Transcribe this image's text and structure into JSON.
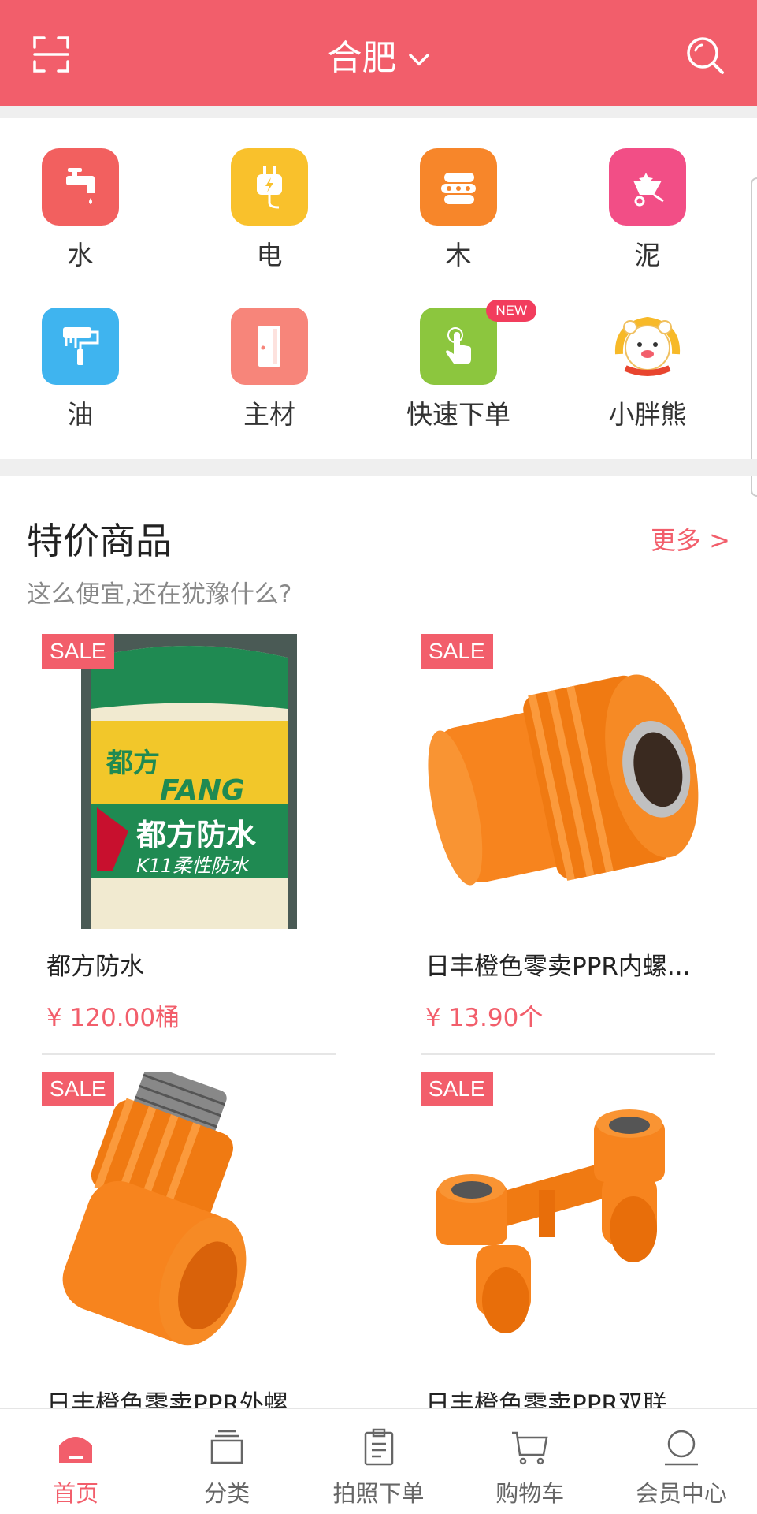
{
  "header": {
    "city": "合肥",
    "scan_icon": "scan-icon",
    "search_icon": "search-icon",
    "bg_color": "#f25e6b"
  },
  "categories": [
    {
      "label": "水",
      "icon": "faucet-icon",
      "color": "#f2605f"
    },
    {
      "label": "电",
      "icon": "plug-icon",
      "color": "#f9c12c"
    },
    {
      "label": "木",
      "icon": "logs-icon",
      "color": "#f7862a"
    },
    {
      "label": "泥",
      "icon": "wheelbarrow-icon",
      "color": "#f24e86"
    },
    {
      "label": "油",
      "icon": "paint-roller-icon",
      "color": "#3fb4ef"
    },
    {
      "label": "主材",
      "icon": "door-icon",
      "color": "#f7857a"
    },
    {
      "label": "快速下单",
      "icon": "tap-hand-icon",
      "color": "#8cc63e",
      "badge": "NEW"
    },
    {
      "label": "小胖熊",
      "icon": "bear-mascot-icon",
      "color": "#ffffff"
    }
  ],
  "sale_section": {
    "title": "特价商品",
    "more": "更多 >",
    "subtitle": "这么便宜,还在犹豫什么?"
  },
  "products": [
    {
      "name": "都方防水",
      "price": "¥ 120.00桶",
      "tag": "SALE",
      "pic_text_1": "都方",
      "pic_text_2": "都方防水",
      "pic_text_3": "K11柔性防水",
      "pic_text_4": "FANG"
    },
    {
      "name": "日丰橙色零卖PPR内螺...",
      "price": "¥ 13.90个",
      "tag": "SALE"
    },
    {
      "name": "日丰橙色零卖PPR外螺",
      "price": "",
      "tag": "SALE"
    },
    {
      "name": "日丰橙色零卖PPR双联",
      "price": "",
      "tag": "SALE"
    }
  ],
  "tabbar": [
    {
      "label": "首页",
      "icon": "home-icon",
      "active": true
    },
    {
      "label": "分类",
      "icon": "category-icon",
      "active": false
    },
    {
      "label": "拍照下单",
      "icon": "clipboard-icon",
      "active": false
    },
    {
      "label": "购物车",
      "icon": "cart-icon",
      "active": false
    },
    {
      "label": "会员中心",
      "icon": "user-icon",
      "active": false
    }
  ],
  "colors": {
    "accent": "#f25e6b",
    "text": "#333333",
    "muted": "#888888"
  }
}
